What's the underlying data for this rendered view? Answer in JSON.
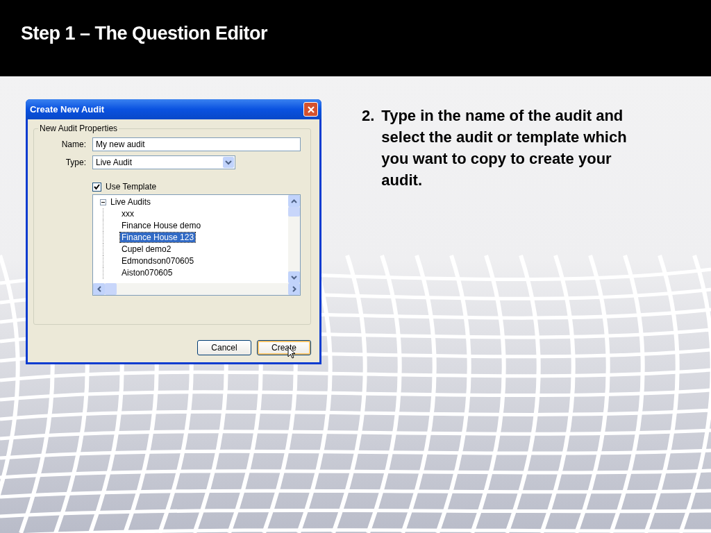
{
  "slide": {
    "title": "Step 1 – The Question Editor"
  },
  "dialog": {
    "title": "Create New Audit",
    "group_label": "New Audit Properties",
    "fields": [
      {
        "kind": "text",
        "label": "Name:",
        "value": "My new audit"
      },
      {
        "kind": "dropdown",
        "label": "Type:",
        "value": "Live Audit"
      }
    ],
    "use_template": {
      "label": "Use Template",
      "checked": true
    },
    "tree": {
      "label": "Live Audits",
      "expanded": true,
      "children": [
        {
          "label": "xxx",
          "selected": false
        },
        {
          "label": "Finance House demo",
          "selected": false
        },
        {
          "label": "Finance House 123",
          "selected": true
        },
        {
          "label": "Cupel demo2",
          "selected": false
        },
        {
          "label": "Edmondson070605",
          "selected": false
        },
        {
          "label": "Aiston070605",
          "selected": false
        }
      ]
    },
    "buttons": [
      {
        "label": "Cancel",
        "default": false
      },
      {
        "label": "Create",
        "default": true
      }
    ]
  },
  "instructions": [
    {
      "number": "2.",
      "text": "Type in the name of the audit and select the audit or template which you want to copy to create your audit."
    }
  ]
}
